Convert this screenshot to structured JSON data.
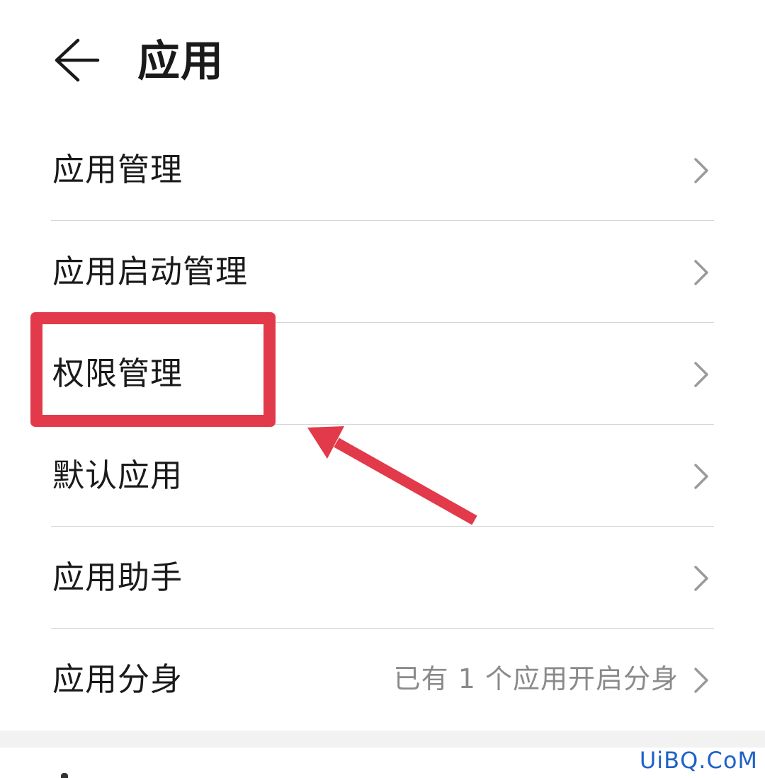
{
  "header": {
    "back_icon": "arrow-left-icon",
    "title": "应用"
  },
  "list": {
    "items": [
      {
        "label": "应用管理",
        "value": ""
      },
      {
        "label": "应用启动管理",
        "value": ""
      },
      {
        "label": "权限管理",
        "value": ""
      },
      {
        "label": "默认应用",
        "value": ""
      },
      {
        "label": "应用助手",
        "value": ""
      },
      {
        "label": "应用分身",
        "value": "已有 1 个应用开启分身"
      }
    ],
    "chevron_icon": "chevron-right-icon"
  },
  "annotation": {
    "highlight_color": "#e23a4a",
    "highlighted_item": "权限管理"
  },
  "watermark": "UiBQ.CoM"
}
